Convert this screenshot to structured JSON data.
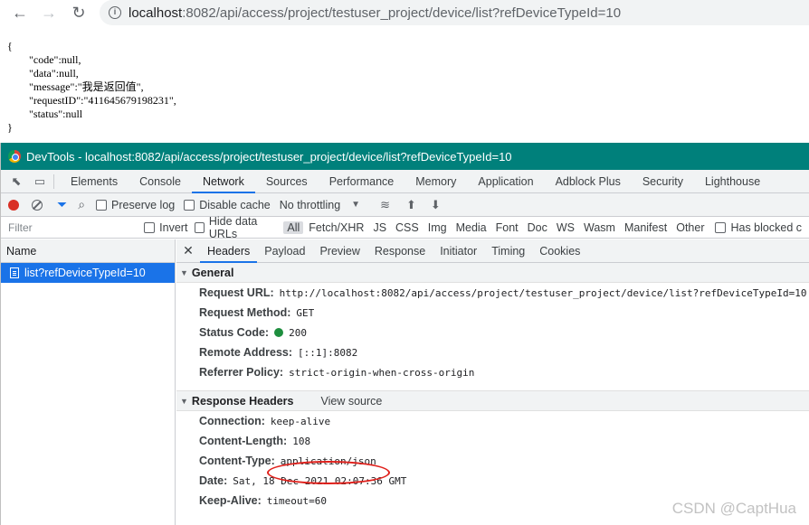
{
  "browser": {
    "url_host": "localhost",
    "url_path": ":8082/api/access/project/testuser_project/device/list?refDeviceTypeId=10",
    "icons": {
      "back": "back-arrow-icon",
      "forward": "forward-arrow-icon",
      "reload": "reload-icon",
      "info": "info-icon"
    }
  },
  "json_body": {
    "line1": "{",
    "line2": "        \"code\":null,",
    "line3": "        \"data\":null,",
    "line4": "        \"message\":\"我是返回值\",",
    "line5": "        \"requestID\":\"411645679198231\",",
    "line6": "        \"status\":null",
    "line7": "}"
  },
  "devtools": {
    "title": "DevTools - localhost:8082/api/access/project/testuser_project/device/list?refDeviceTypeId=10",
    "main_tabs": [
      "Elements",
      "Console",
      "Network",
      "Sources",
      "Performance",
      "Memory",
      "Application",
      "Adblock Plus",
      "Security",
      "Lighthouse"
    ],
    "active_tab": "Network",
    "toolbar": {
      "preserve_log": "Preserve log",
      "disable_cache": "Disable cache",
      "throttling": "No throttling"
    },
    "filter_row": {
      "placeholder": "Filter",
      "invert": "Invert",
      "hide_data_urls": "Hide data URLs",
      "types": [
        "All",
        "Fetch/XHR",
        "JS",
        "CSS",
        "Img",
        "Media",
        "Font",
        "Doc",
        "WS",
        "Wasm",
        "Manifest",
        "Other"
      ],
      "has_blocked": "Has blocked c"
    },
    "left_pane": {
      "header": "Name",
      "request": "list?refDeviceTypeId=10"
    },
    "detail_tabs": [
      "Headers",
      "Payload",
      "Preview",
      "Response",
      "Initiator",
      "Timing",
      "Cookies"
    ],
    "general": {
      "title": "General",
      "rows": [
        {
          "k": "Request URL:",
          "v": "http://localhost:8082/api/access/project/testuser_project/device/list?refDeviceTypeId=10"
        },
        {
          "k": "Request Method:",
          "v": "GET"
        },
        {
          "k": "Status Code:",
          "v": "200"
        },
        {
          "k": "Remote Address:",
          "v": "[::1]:8082"
        },
        {
          "k": "Referrer Policy:",
          "v": "strict-origin-when-cross-origin"
        }
      ]
    },
    "response_headers": {
      "title": "Response Headers",
      "view_source": "View source",
      "rows": [
        {
          "k": "Connection:",
          "v": "keep-alive"
        },
        {
          "k": "Content-Length:",
          "v": "108"
        },
        {
          "k": "Content-Type:",
          "v": "application/json"
        },
        {
          "k": "Date:",
          "v": "Sat, 18 Dec 2021 02:07:36 GMT"
        },
        {
          "k": "Keep-Alive:",
          "v": "timeout=60"
        }
      ]
    }
  },
  "watermark": "CSDN @CaptHua",
  "colors": {
    "titlebar": "#00807b",
    "accent": "#1a73e8",
    "annotation": "#e0201b"
  }
}
